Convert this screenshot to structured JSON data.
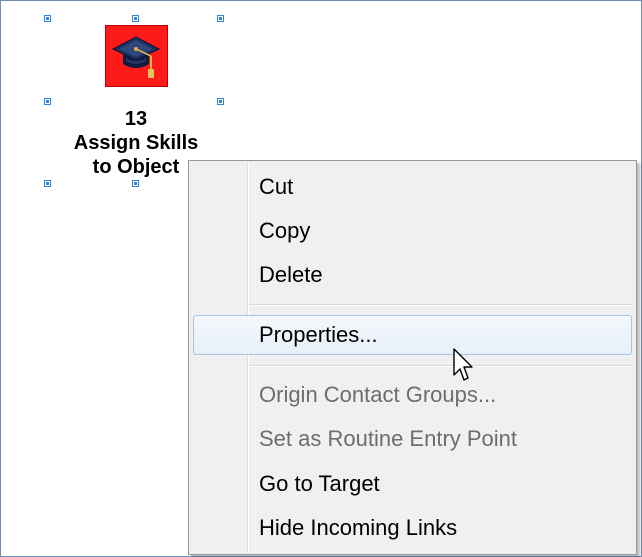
{
  "diagram": {
    "node": {
      "icon": "graduation-cap-icon",
      "number": "13",
      "label_line1": "Assign Skills",
      "label_line2": "to Object"
    }
  },
  "context_menu": {
    "items": [
      {
        "label": "Cut",
        "enabled": true
      },
      {
        "label": "Copy",
        "enabled": true
      },
      {
        "label": "Delete",
        "enabled": true
      },
      {
        "label": "Properties...",
        "enabled": true,
        "highlighted": true
      },
      {
        "label": "Origin Contact Groups...",
        "enabled": false
      },
      {
        "label": "Set as Routine Entry Point",
        "enabled": false
      },
      {
        "label": "Go to Target",
        "enabled": true
      },
      {
        "label": "Hide Incoming Links",
        "enabled": true
      }
    ]
  },
  "colors": {
    "node_fill": "#ff1a1a",
    "handle": "#2f86d8",
    "menu_bg": "#f0f0f0",
    "highlight_border": "#a9c3e3",
    "disabled_text": "#6d6d6d"
  }
}
